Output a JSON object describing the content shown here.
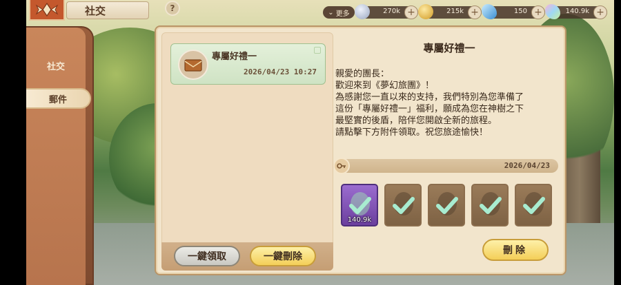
{
  "header": {
    "title": "社交",
    "help_label": "?",
    "more_label": "更多",
    "resources": [
      {
        "name": "silver-coin",
        "value": "270k",
        "color": "#b9c4d8"
      },
      {
        "name": "gold-coin",
        "value": "215k",
        "color": "#e7b53a"
      },
      {
        "name": "blue-crystal",
        "value": "150",
        "color": "#5fb2e8"
      },
      {
        "name": "rainbow-crystal",
        "value": "140.9k",
        "color": "#b7e1a0"
      }
    ],
    "plus_label": "+"
  },
  "sidebar": {
    "items": [
      {
        "label": "社交",
        "active": false
      },
      {
        "label": "郵件",
        "active": true
      }
    ]
  },
  "mail_list": {
    "items": [
      {
        "title": "專屬好禮一",
        "date": "2026/04/23  10:27"
      }
    ],
    "claim_all_label": "一鍵領取",
    "delete_all_label": "一鍵刪除"
  },
  "mail_detail": {
    "title": "專屬好禮一",
    "body_lines": [
      "親愛的團長：",
      "歡迎來到《夢幻旅團》！",
      "為感謝您一直以來的支持，我們特別為您準備了",
      "這份「專屬好禮一」福利，願成為您在神樹之下",
      "最堅實的後盾，陪伴您開啟全新的旅程。",
      "請點擊下方附件領取。祝您旅途愉快！"
    ],
    "attachment_date": "2026/04/23",
    "attachments": [
      {
        "icon": "crystal-item-icon",
        "qty": "140.9k",
        "rarity": "purple",
        "claimed": true
      },
      {
        "icon": "pouch-item-icon",
        "qty": "",
        "rarity": "brown",
        "claimed": true
      },
      {
        "icon": "ring-item-icon",
        "qty": "",
        "rarity": "brown",
        "claimed": true
      },
      {
        "icon": "bow-item-icon",
        "qty": "",
        "rarity": "brown",
        "claimed": true
      },
      {
        "icon": "scroll-item-icon",
        "qty": "",
        "rarity": "brown",
        "claimed": true
      }
    ],
    "delete_label": "刪除"
  }
}
